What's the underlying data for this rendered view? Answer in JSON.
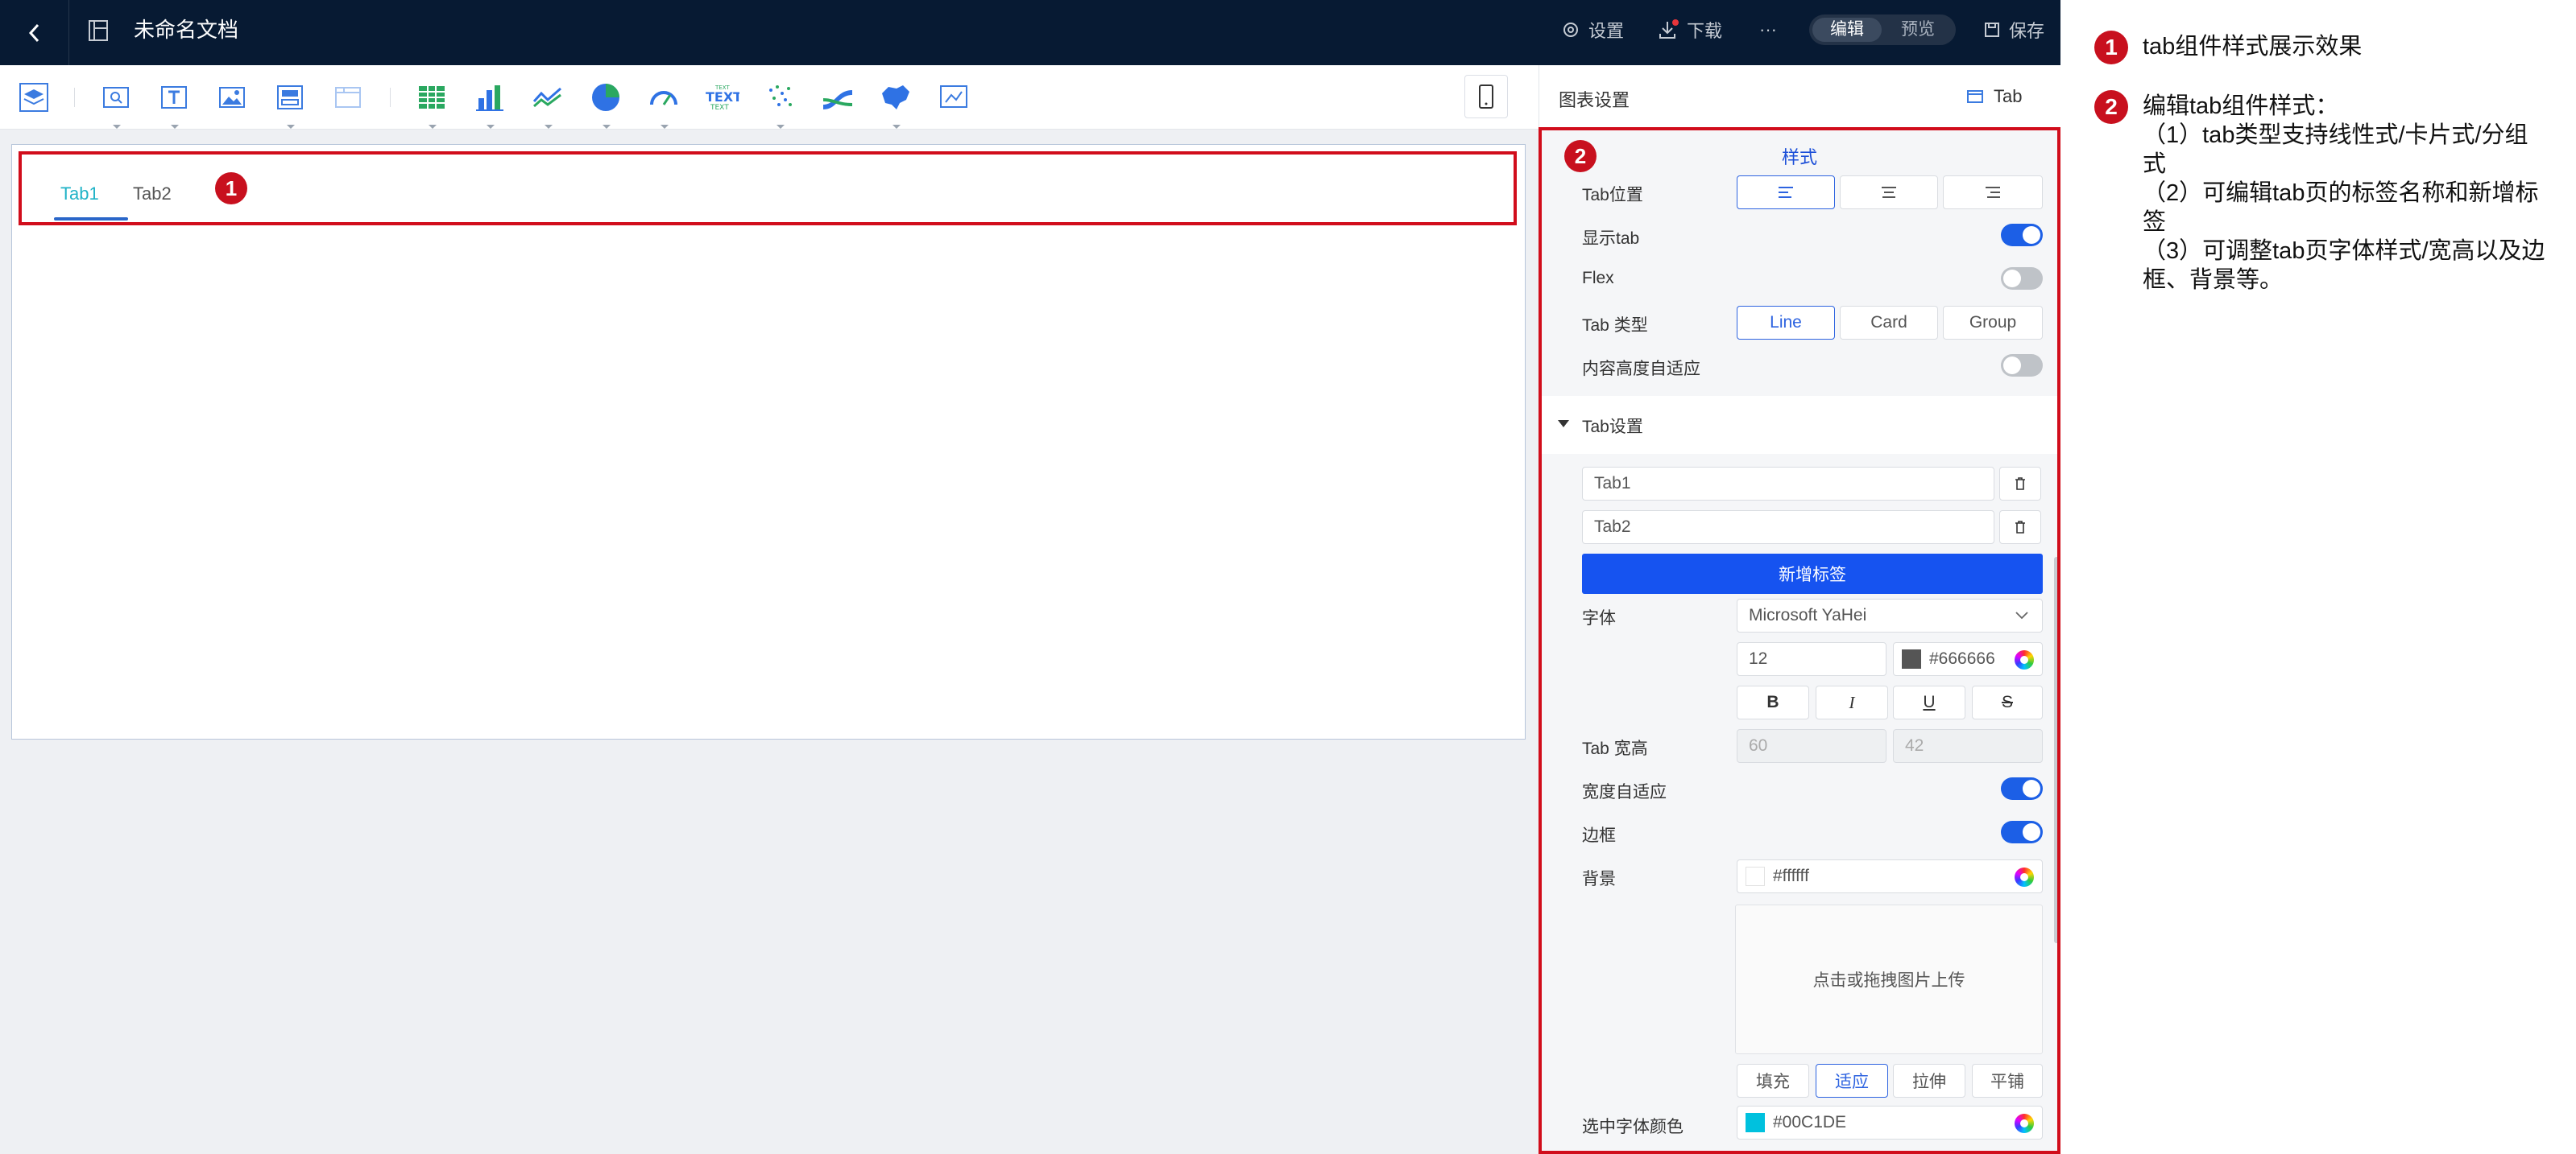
{
  "topbar": {
    "title": "未命名文档",
    "settings_label": "设置",
    "download_label": "下载",
    "more_label": "···",
    "mode_edit": "编辑",
    "mode_preview": "预览",
    "save_label": "保存"
  },
  "canvas": {
    "tabs": [
      {
        "label": "Tab1"
      },
      {
        "label": "Tab2"
      }
    ],
    "badge": "1"
  },
  "sidebar": {
    "header_title": "图表设置",
    "header_component": "Tab",
    "badge": "2",
    "style_title": "样式",
    "tab_position_label": "Tab位置",
    "show_tab_label": "显示tab",
    "flex_label": "Flex",
    "tab_type_label": "Tab 类型",
    "tab_types": [
      "Line",
      "Card",
      "Group"
    ],
    "content_height_label": "内容高度自适应",
    "tab_settings_label": "Tab设置",
    "tab_items": [
      "Tab1",
      "Tab2"
    ],
    "add_tab_label": "新增标签",
    "font_label": "字体",
    "font_family": "Microsoft YaHei",
    "font_size": "12",
    "font_color": "#666666",
    "text_styles": [
      "B",
      "I",
      "U",
      "S"
    ],
    "tab_size_label": "Tab 宽高",
    "tab_width": "60",
    "tab_height": "42",
    "auto_width_label": "宽度自适应",
    "border_label": "边框",
    "background_label": "背景",
    "background_color": "#ffffff",
    "upload_text": "点击或拖拽图片上传",
    "fit_modes": [
      "填充",
      "适应",
      "拉伸",
      "平铺"
    ],
    "selected_font_color_label": "选中字体颜色",
    "selected_font_color": "#00C1DE"
  },
  "notes": {
    "n1_badge": "1",
    "n1_text": "tab组件样式展示效果",
    "n2_badge": "2",
    "n2_title": "编辑tab组件样式：",
    "n2_line1": "（1）tab类型支持线性式/卡片式/分组式",
    "n2_line2": "（2）可编辑tab页的标签名称和新增标签",
    "n2_line3": "（3）可调整tab页字体样式/宽高以及边框、背景等。"
  },
  "colors": {
    "accent": "#1c5fe6",
    "annotation_red": "#d10d1b",
    "active_tab": "#20b3c7",
    "selected_font_color": "#00C1DE"
  }
}
